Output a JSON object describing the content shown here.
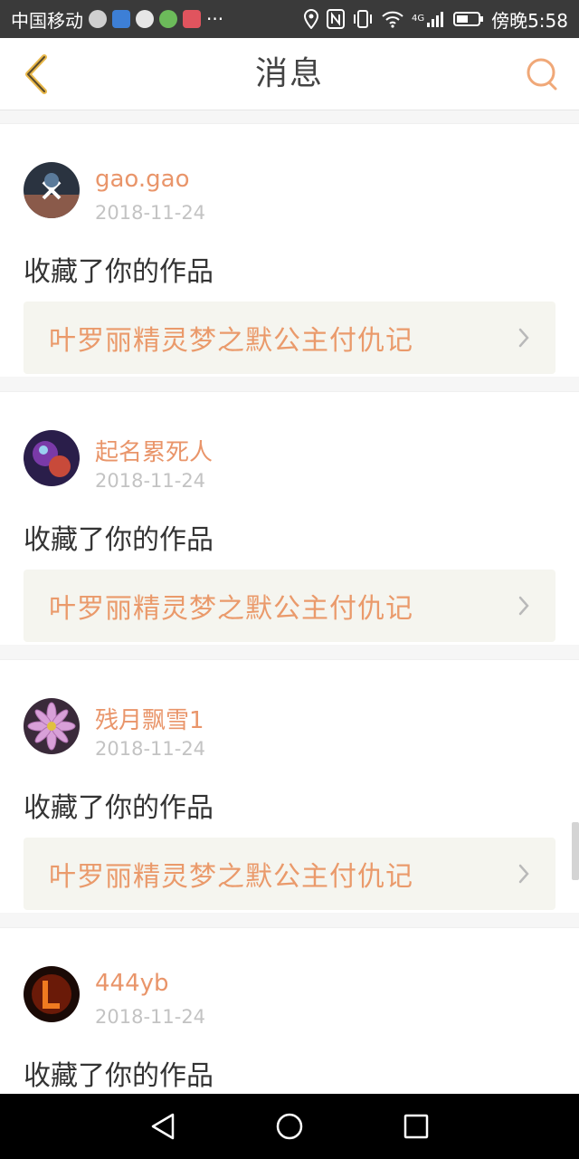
{
  "status_bar": {
    "carrier": "中国移动",
    "right_text": "傍晚5:58",
    "network_label": "4G",
    "more": "···",
    "icons": [
      "signal-app-icon",
      "shield-app-icon",
      "message-app-icon",
      "browser-app-icon",
      "book-app-icon",
      "location-icon",
      "nfc-icon",
      "vibrate-icon",
      "wifi-icon",
      "cell-signal-icon",
      "battery-icon"
    ]
  },
  "nav": {
    "title": "消息",
    "back_icon": "chevron-left-icon",
    "search_icon": "search-icon",
    "accent": "#e9956a"
  },
  "messages": [
    {
      "username": "gao.gao",
      "date": "2018-11-24",
      "action": "收藏了你的作品",
      "work_title": "叶罗丽精灵梦之默公主付仇记"
    },
    {
      "username": "起名累死人",
      "date": "2018-11-24",
      "action": "收藏了你的作品",
      "work_title": "叶罗丽精灵梦之默公主付仇记"
    },
    {
      "username": "残月飘雪1",
      "date": "2018-11-24",
      "action": "收藏了你的作品",
      "work_title": "叶罗丽精灵梦之默公主付仇记"
    },
    {
      "username": "444yb",
      "date": "2018-11-24",
      "action": "收藏了你的作品",
      "work_title": ""
    }
  ],
  "system_nav": {
    "back": "triangle-back-icon",
    "home": "circle-home-icon",
    "recents": "square-recents-icon"
  }
}
